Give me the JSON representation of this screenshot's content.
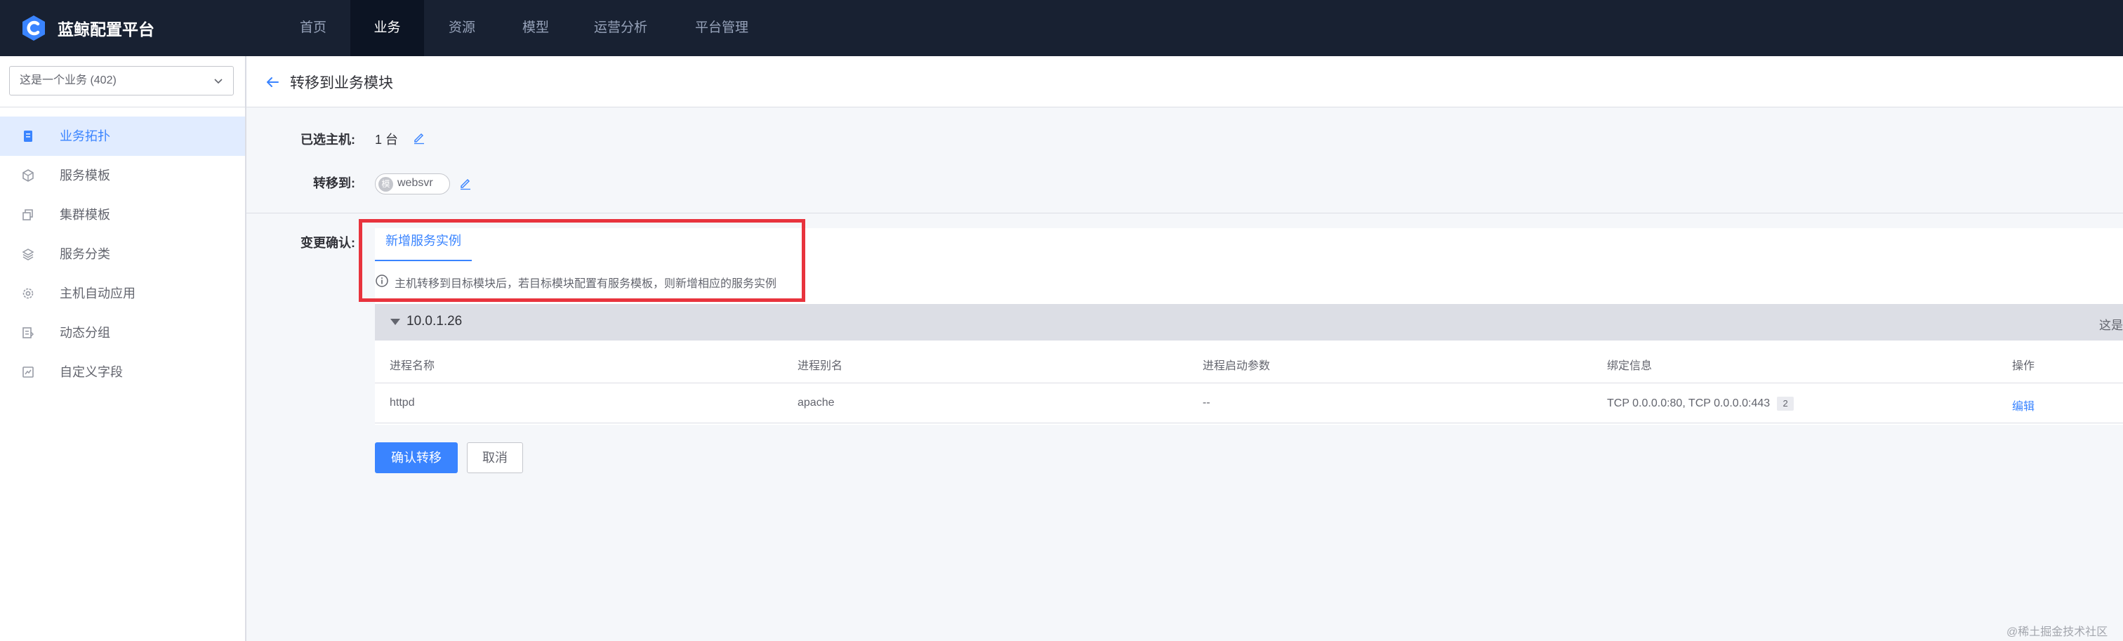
{
  "app": {
    "title": "蓝鲸配置平台"
  },
  "nav": {
    "items": [
      "首页",
      "业务",
      "资源",
      "模型",
      "运营分析",
      "平台管理"
    ],
    "active": "业务"
  },
  "sidebar": {
    "business_selector": "这是一个业务 (402)",
    "items": [
      {
        "label": "业务拓扑",
        "icon": "topology-icon",
        "active": true
      },
      {
        "label": "服务模板",
        "icon": "cube-icon",
        "active": false
      },
      {
        "label": "集群模板",
        "icon": "stack-icon",
        "active": false
      },
      {
        "label": "服务分类",
        "icon": "layers-icon",
        "active": false
      },
      {
        "label": "主机自动应用",
        "icon": "gear-icon",
        "active": false
      },
      {
        "label": "动态分组",
        "icon": "group-icon",
        "active": false
      },
      {
        "label": "自定义字段",
        "icon": "field-icon",
        "active": false
      }
    ]
  },
  "page": {
    "title": "转移到业务模块"
  },
  "form": {
    "selected_hosts_label": "已选主机:",
    "selected_hosts_value": "1 台",
    "transfer_to_label": "转移到:",
    "target_tag_badge": "模",
    "target_tag": "websvr",
    "change_confirm_label": "变更确认:"
  },
  "tabs": {
    "active": "新增服务实例"
  },
  "tip": {
    "text": "主机转移到目标模块后，若目标模块配置有服务模板，则新增相应的服务实例"
  },
  "host_group": {
    "ip": "10.0.1.26",
    "right_text": "这是"
  },
  "table": {
    "columns": [
      "进程名称",
      "进程别名",
      "进程启动参数",
      "绑定信息",
      "操作"
    ],
    "rows": [
      {
        "name": "httpd",
        "alias": "apache",
        "params": "--",
        "bind": "TCP 0.0.0.0:80, TCP 0.0.0.0:443",
        "bind_count": "2",
        "action": "编辑"
      }
    ]
  },
  "buttons": {
    "confirm": "确认转移",
    "cancel": "取消"
  },
  "watermark": "@稀土掘金技术社区",
  "colors": {
    "accent": "#3a84ff",
    "topbar": "#182132",
    "highlight": "#e8333d"
  }
}
